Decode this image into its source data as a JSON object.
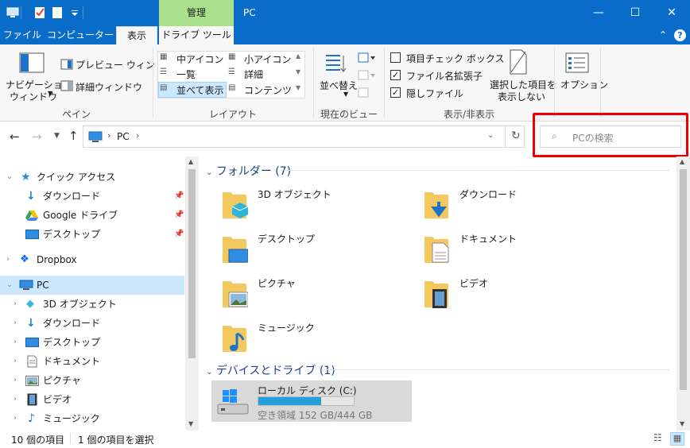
{
  "window": {
    "title": "PC",
    "context_tab": "管理",
    "controls": {
      "minimize": "—",
      "maximize": "☐",
      "close": "✕"
    }
  },
  "ribbon_tabs": [
    {
      "label": "ファイル"
    },
    {
      "label": "コンピューター"
    },
    {
      "label": "表示"
    },
    {
      "label": "ドライブ ツール"
    }
  ],
  "ribbon": {
    "pane": {
      "nav_pane_line1": "ナビゲーション",
      "nav_pane_line2": "ウィンドウ",
      "preview": "プレビュー ウィンドウ",
      "details": "詳細ウィンドウ",
      "group_label": "ペイン"
    },
    "layout": {
      "items": [
        "中アイコン",
        "小アイコン",
        "一覧",
        "詳細",
        "並べて表示",
        "コンテンツ"
      ],
      "selected": "並べて表示",
      "group_label": "レイアウト"
    },
    "current_view": {
      "sort": "並べ替え",
      "group_label": "現在のビュー"
    },
    "show_hide": {
      "checkboxes": [
        {
          "label": "項目チェック ボックス",
          "checked": false
        },
        {
          "label": "ファイル名拡張子",
          "checked": true
        },
        {
          "label": "隠しファイル",
          "checked": true
        }
      ],
      "hide_selected_line1": "選択した項目を",
      "hide_selected_line2": "表示しない",
      "group_label": "表示/非表示"
    },
    "options": {
      "label": "オプション"
    }
  },
  "address": {
    "path": [
      "PC"
    ],
    "search_placeholder": "PCの検索"
  },
  "nav_pane": {
    "quick_access": "クイック アクセス",
    "quick_items": [
      "ダウンロード",
      "Google ドライブ",
      "デスクトップ"
    ],
    "dropbox": "Dropbox",
    "pc": "PC",
    "pc_items": [
      "3D オブジェクト",
      "ダウンロード",
      "デスクトップ",
      "ドキュメント",
      "ピクチャ",
      "ビデオ",
      "ミュージック"
    ]
  },
  "content": {
    "folders_group": "フォルダー (7)",
    "folders": [
      "3D オブジェクト",
      "ダウンロード",
      "デスクトップ",
      "ドキュメント",
      "ピクチャ",
      "ビデオ",
      "ミュージック"
    ],
    "devices_group": "デバイスとドライブ (1)",
    "drive": {
      "name": "ローカル ディスク (C:)",
      "free_text": "空き領域 152 GB/444 GB",
      "used_fraction": 0.658
    }
  },
  "status": {
    "count": "10 個の項目",
    "selected": "1 個の項目を選択"
  },
  "colors": {
    "titlebar": "#0a6cc9",
    "context_tab": "#a8e08c",
    "selection": "#cce8ff",
    "highlight": "#e00000",
    "drive_bar": "#26a0da"
  }
}
